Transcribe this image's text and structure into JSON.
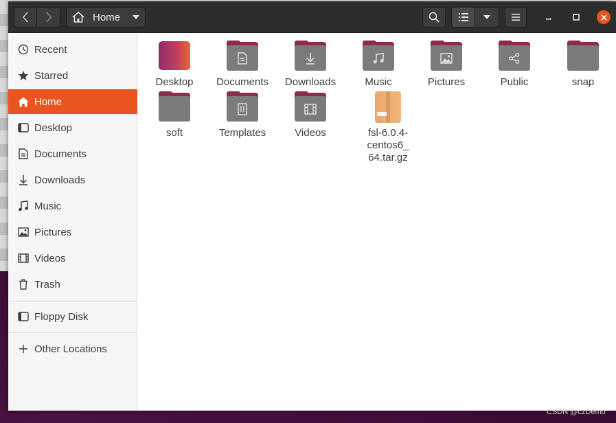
{
  "window": {
    "path_label": "Home"
  },
  "sidebar": {
    "items": [
      {
        "label": "Recent",
        "icon": "clock-icon"
      },
      {
        "label": "Starred",
        "icon": "star-icon"
      },
      {
        "label": "Home",
        "icon": "home-icon",
        "active": true
      },
      {
        "label": "Desktop",
        "icon": "desktop-icon"
      },
      {
        "label": "Documents",
        "icon": "document-icon"
      },
      {
        "label": "Downloads",
        "icon": "download-icon"
      },
      {
        "label": "Music",
        "icon": "music-icon"
      },
      {
        "label": "Pictures",
        "icon": "picture-icon"
      },
      {
        "label": "Videos",
        "icon": "video-icon"
      },
      {
        "label": "Trash",
        "icon": "trash-icon"
      },
      {
        "label": "Floppy Disk",
        "icon": "floppy-icon"
      },
      {
        "label": "Other Locations",
        "icon": "plus-icon"
      }
    ]
  },
  "files": [
    {
      "name": "Desktop",
      "icon": "desktop-folder-icon"
    },
    {
      "name": "Documents",
      "icon": "documents-folder-icon"
    },
    {
      "name": "Downloads",
      "icon": "downloads-folder-icon"
    },
    {
      "name": "Music",
      "icon": "music-folder-icon"
    },
    {
      "name": "Pictures",
      "icon": "pictures-folder-icon"
    },
    {
      "name": "Public",
      "icon": "public-folder-icon"
    },
    {
      "name": "snap",
      "icon": "folder-icon"
    },
    {
      "name": "soft",
      "icon": "folder-icon"
    },
    {
      "name": "Templates",
      "icon": "templates-folder-icon"
    },
    {
      "name": "Videos",
      "icon": "videos-folder-icon"
    },
    {
      "name": "fsl-6.0.4-centos6_64.tar.gz",
      "icon": "archive-icon"
    }
  ],
  "watermark": "CSDN @czDemo",
  "colors": {
    "accent": "#e95420",
    "headerbar": "#2d2d2d",
    "folder_tab": "#8c2a4f",
    "folder_body": "#7b7b7b"
  }
}
